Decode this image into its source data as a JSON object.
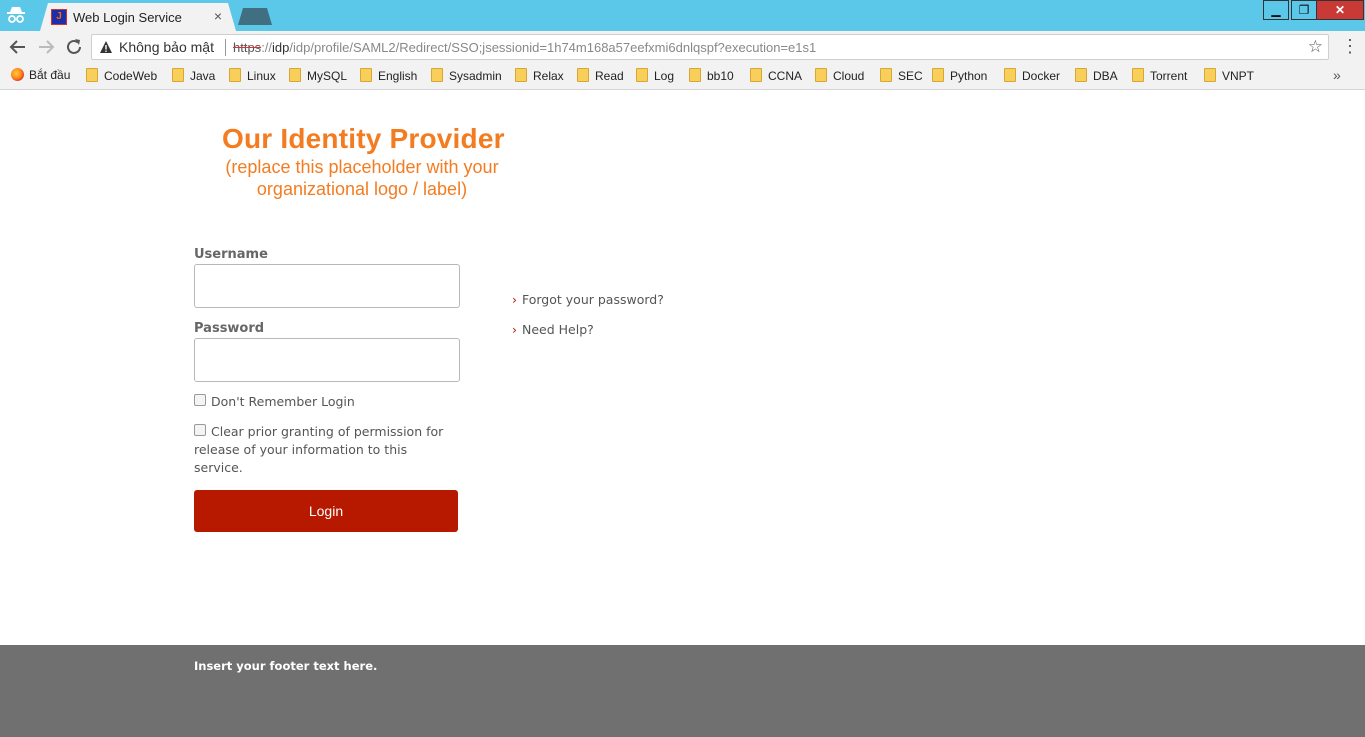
{
  "browser": {
    "tab_title": "Web Login Service",
    "tab_close": "×",
    "security_label": "Không bảo mật",
    "url_scheme": "https",
    "url_sep": "://",
    "url_host": "idp",
    "url_rest": "/idp/profile/SAML2/Redirect/SSO;jsessionid=1h74m168a57eefxmi6dnlqspf?execution=e1s1",
    "window_controls": {
      "minimize": "▁",
      "maximize": "❐",
      "close": "✕"
    },
    "bookmarks": [
      {
        "label": "Bắt đầu",
        "icon": "firefox-icon"
      },
      {
        "label": "CodeWeb",
        "icon": "folder-icon"
      },
      {
        "label": "Java",
        "icon": "folder-icon"
      },
      {
        "label": "Linux",
        "icon": "folder-icon"
      },
      {
        "label": "MySQL",
        "icon": "folder-icon"
      },
      {
        "label": "English",
        "icon": "folder-icon"
      },
      {
        "label": "Sysadmin",
        "icon": "folder-icon"
      },
      {
        "label": "Relax",
        "icon": "folder-icon"
      },
      {
        "label": "Read",
        "icon": "folder-icon"
      },
      {
        "label": "Log",
        "icon": "folder-icon"
      },
      {
        "label": "bb10",
        "icon": "folder-icon"
      },
      {
        "label": "CCNA",
        "icon": "folder-icon"
      },
      {
        "label": "Cloud",
        "icon": "folder-icon"
      },
      {
        "label": "SEC",
        "icon": "folder-icon"
      },
      {
        "label": "Python",
        "icon": "folder-icon"
      },
      {
        "label": "Docker",
        "icon": "folder-icon"
      },
      {
        "label": "DBA",
        "icon": "folder-icon"
      },
      {
        "label": "Torrent",
        "icon": "folder-icon"
      },
      {
        "label": "VNPT",
        "icon": "folder-icon"
      }
    ],
    "bookmarks_more": "»"
  },
  "logo": {
    "title": "Our Identity Provider",
    "subtitle": "(replace this placeholder with your organizational logo / label)"
  },
  "form": {
    "username_label": "Username",
    "username_value": "",
    "password_label": "Password",
    "password_value": "",
    "dont_remember": "Don't Remember Login",
    "clear_consent": "Clear prior granting of permission for release of your information to this service.",
    "login_button": "Login"
  },
  "links": {
    "arrow": "›",
    "forgot": "Forgot your password?",
    "help": "Need Help?"
  },
  "footer": {
    "text": "Insert your footer text here."
  },
  "colors": {
    "accent": "#f47c20",
    "button": "#b61800",
    "footer_bg": "#707070",
    "titlebar": "#5bc8ea"
  }
}
